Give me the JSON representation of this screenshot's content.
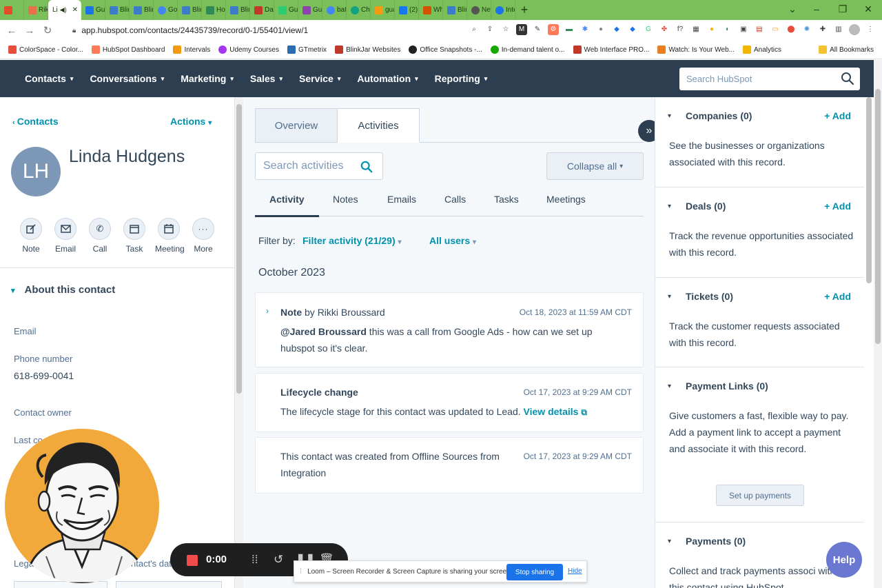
{
  "browser": {
    "tabs": [
      {
        "label": "",
        "color": "#e34c26"
      },
      {
        "label": "Rikk",
        "color": "#e8714a"
      },
      {
        "label": "Li",
        "color": "#ff7a59",
        "active": true
      },
      {
        "label": "Gua",
        "color": "#1a73e8"
      },
      {
        "label": "Blin",
        "color": "#3d7cc9"
      },
      {
        "label": "Blin",
        "color": "#3d7cc9"
      },
      {
        "label": "Goo",
        "color": "#4285f4"
      },
      {
        "label": "Blin",
        "color": "#3d7cc9"
      },
      {
        "label": "Hon",
        "color": "#2e8b57"
      },
      {
        "label": "Blin",
        "color": "#3d7cc9"
      },
      {
        "label": "Dasl",
        "color": "#c0392b"
      },
      {
        "label": "Gua",
        "color": "#2ecc71"
      },
      {
        "label": "Gulf",
        "color": "#8e44ad"
      },
      {
        "label": "batc",
        "color": "#4285f4"
      },
      {
        "label": "Cha",
        "color": "#10a37f"
      },
      {
        "label": "gua",
        "color": "#f39c12"
      },
      {
        "label": "(2) Ji",
        "color": "#1877f2"
      },
      {
        "label": "Whe",
        "color": "#d35400"
      },
      {
        "label": "Blin",
        "color": "#3d7cc9"
      },
      {
        "label": "New",
        "color": "#555555"
      },
      {
        "label": "Inte",
        "color": "#1a73e8"
      }
    ],
    "url": "app.hubspot.com/contacts/24435739/record/0-1/55401/view/1",
    "bookmarks": [
      {
        "label": "ColorSpace - Color...",
        "color": "#e74c3c"
      },
      {
        "label": "HubSpot Dashboard",
        "color": "#ff7a59"
      },
      {
        "label": "Intervals",
        "color": "#f39c12"
      },
      {
        "label": "Udemy Courses",
        "color": "#a435f0"
      },
      {
        "label": "GTmetrix",
        "color": "#2c6bb0"
      },
      {
        "label": "BlinkJar Websites",
        "color": "#c0392b"
      },
      {
        "label": "Office Snapshots -...",
        "color": "#222222"
      },
      {
        "label": "In-demand talent o...",
        "color": "#14a800"
      },
      {
        "label": "Web Interface PRO...",
        "color": "#c0392b"
      },
      {
        "label": "Watch: Is Your Web...",
        "color": "#e67e22"
      },
      {
        "label": "Analytics",
        "color": "#f4b400"
      }
    ],
    "all_bookmarks": "All Bookmarks"
  },
  "nav": {
    "items": [
      "Contacts",
      "Conversations",
      "Marketing",
      "Sales",
      "Service",
      "Automation",
      "Reporting"
    ],
    "search_placeholder": "Search HubSpot"
  },
  "contact": {
    "back_label": "Contacts",
    "actions_label": "Actions",
    "initials": "LH",
    "name": "Linda Hudgens",
    "quick_actions": [
      "Note",
      "Email",
      "Call",
      "Task",
      "Meeting",
      "More"
    ],
    "about_title": "About this contact",
    "fields": {
      "email_label": "Email",
      "phone_label": "Phone number",
      "phone_value": "618-699-0041",
      "owner_label": "Contact owner",
      "last_contacted_label": "Last co",
      "legal_label": "Lega",
      "contact_data_label": "ntact's data"
    }
  },
  "activities": {
    "tabs": [
      "Overview",
      "Activities"
    ],
    "search_placeholder": "Search activities",
    "collapse_label": "Collapse all",
    "sub_tabs": [
      "Activity",
      "Notes",
      "Emails",
      "Calls",
      "Tasks",
      "Meetings"
    ],
    "filter_by": "Filter by:",
    "filter_activity": "Filter activity (21/29)",
    "all_users": "All users",
    "month": "October 2023",
    "items": [
      {
        "type": "Note",
        "by": "by Rikki Broussard",
        "time": "Oct 18, 2023 at 11:59 AM CDT",
        "mention": "@Jared Broussard",
        "body_1": " this was a call from Google Ads - how can we set up",
        "body_2": "hubspot so it's clear."
      },
      {
        "type": "Lifecycle change",
        "time": "Oct 17, 2023 at 9:29 AM CDT",
        "body": "The lifecycle stage for this contact was updated to Lead.",
        "link": "View details"
      },
      {
        "time": "Oct 17, 2023 at 9:29 AM CDT",
        "body_1": "This contact was created from Offline Sources from",
        "body_2": "Integration"
      }
    ]
  },
  "sidebar_right": {
    "add_label": "+ Add",
    "sections": [
      {
        "title": "Companies (0)",
        "desc": "See the businesses or organizations associated with this record."
      },
      {
        "title": "Deals (0)",
        "desc": "Track the revenue opportunities associated with this record."
      },
      {
        "title": "Tickets (0)",
        "desc": "Track the customer requests associated with this record."
      },
      {
        "title": "Payment Links (0)",
        "desc": "Give customers a fast, flexible way to pay. Add a payment link to accept a payment and associate it with this record."
      },
      {
        "title": "Payments (0)",
        "desc": "Collect and track payments associ with this contact using HubSpot"
      }
    ],
    "setup_payments": "Set up payments"
  },
  "loom": {
    "timer": "0:00",
    "share_text": "Loom – Screen Recorder & Screen Capture is sharing your screen.",
    "stop_label": "Stop sharing",
    "hide_label": "Hide"
  },
  "help_label": "Help",
  "colors": {
    "nav_bg": "#2d3e50",
    "link": "#0091ae",
    "browser_accent": "#7bbf5a",
    "webcam_bg": "#f2a93b"
  }
}
